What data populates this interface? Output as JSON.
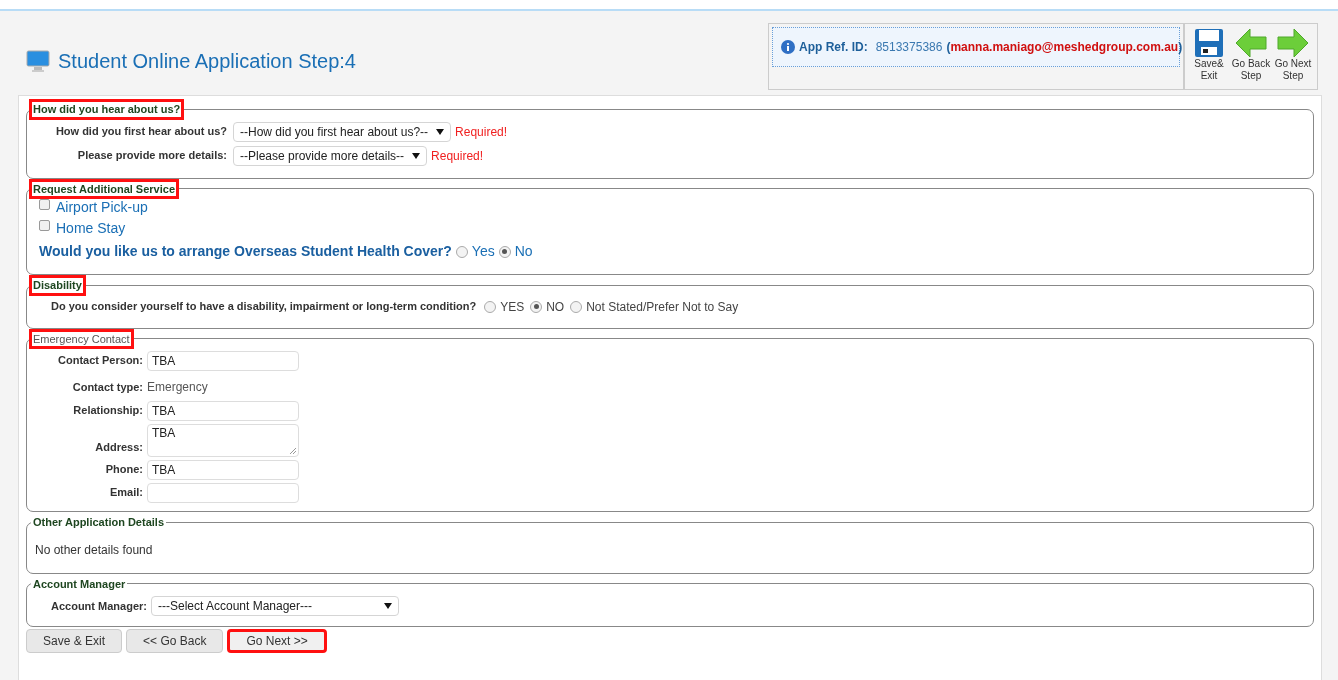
{
  "header": {
    "title": "Student Online Application Step:4",
    "ref_label": "App Ref. ID:",
    "ref_id": "8513375386",
    "email_open": "(",
    "email": "manna.maniago@meshedgroup.com.au",
    "email_close": ")"
  },
  "toolbar": [
    {
      "kind": "save",
      "lines": [
        "Save&",
        "Exit"
      ]
    },
    {
      "kind": "back",
      "lines": [
        "Go Back",
        "Step"
      ]
    },
    {
      "kind": "next",
      "lines": [
        "Go Next",
        "Step"
      ]
    }
  ],
  "sections": [
    {
      "kind": "selects",
      "legend": "How did you hear about us?",
      "bold": true,
      "highlighted": true,
      "rows": [
        {
          "label": "How did you first hear about us?",
          "value": "--How did you first hear about us?--",
          "note": "Required!"
        },
        {
          "label": "Please provide more details:",
          "value": "--Please provide more details--",
          "note": "Required!"
        }
      ]
    },
    {
      "kind": "services",
      "legend": "Request Additional Service",
      "bold": true,
      "highlighted": true,
      "checks": [
        {
          "label": "Airport Pick-up",
          "checked": false
        },
        {
          "label": "Home Stay",
          "checked": false
        }
      ],
      "question": "Would you like us to arrange Overseas Student Health Cover?",
      "options": [
        {
          "label": "Yes",
          "selected": false
        },
        {
          "label": "No",
          "selected": true
        }
      ]
    },
    {
      "kind": "radio",
      "legend": "Disability",
      "bold": true,
      "highlighted": true,
      "question": "Do you consider yourself to have a disability, impairment or long-term condition?",
      "options": [
        {
          "label": "YES",
          "selected": false
        },
        {
          "label": "NO",
          "selected": true
        },
        {
          "label": "Not Stated/Prefer Not to Say",
          "selected": false
        }
      ]
    },
    {
      "kind": "contact",
      "legend": "Emergency Contact",
      "bold": false,
      "highlighted": true,
      "fields": [
        {
          "kind": "input",
          "label": "Contact Person:",
          "value": "TBA"
        },
        {
          "kind": "text",
          "label": "Contact type:",
          "value": "Emergency"
        },
        {
          "kind": "input",
          "label": "Relationship:",
          "value": "TBA"
        },
        {
          "kind": "textarea",
          "label": "Address:",
          "value": "TBA"
        },
        {
          "kind": "input",
          "label": "Phone:",
          "value": "TBA"
        },
        {
          "kind": "input",
          "label": "Email:"
        }
      ]
    },
    {
      "kind": "note",
      "legend": "Other Application Details",
      "bold": true,
      "highlighted": false,
      "text": "No other details found"
    },
    {
      "kind": "select",
      "legend": "Account Manager",
      "bold": true,
      "highlighted": false,
      "label": "Account Manager:",
      "value": "---Select Account Manager---"
    }
  ],
  "buttons": [
    {
      "label": "Save & Exit",
      "highlighted": false
    },
    {
      "label": "<< Go Back",
      "highlighted": false
    },
    {
      "label": "Go Next >>",
      "highlighted": true
    }
  ]
}
